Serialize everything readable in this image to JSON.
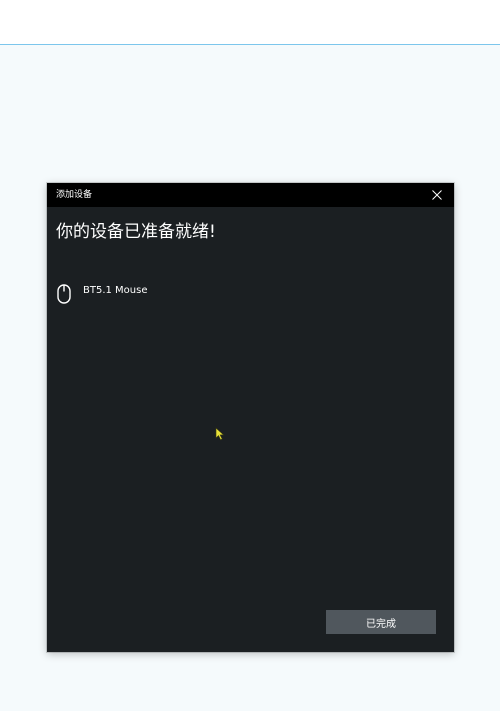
{
  "dialog": {
    "title": "添加设备",
    "heading": "你的设备已准备就绪!",
    "device": {
      "name": "BT5.1 Mouse",
      "icon": "mouse-icon"
    },
    "done_label": "已完成",
    "close_icon": "close-icon"
  },
  "colors": {
    "page_background": "#f5fafc",
    "top_border": "#7cc6ec",
    "dialog_background": "#1b1f22",
    "titlebar_background": "#000000",
    "button_background": "#50575d",
    "text": "#ffffff",
    "cursor": "#e8e23a"
  }
}
